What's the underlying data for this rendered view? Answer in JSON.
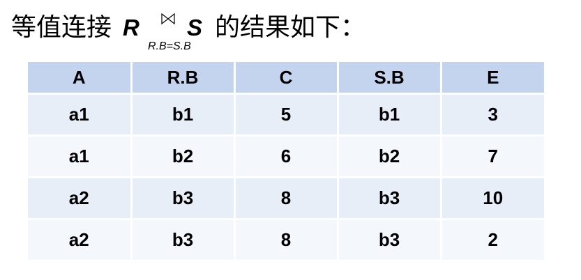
{
  "heading": {
    "prefix": "等值连接",
    "left_relation": "R",
    "join_symbol": "join-icon",
    "join_condition": "R.B=S.B",
    "right_relation": "S",
    "suffix": "的结果如下："
  },
  "table": {
    "headers": [
      "A",
      "R.B",
      "C",
      "S.B",
      "E"
    ],
    "rows": [
      [
        "a1",
        "b1",
        "5",
        "b1",
        "3"
      ],
      [
        "a1",
        "b2",
        "6",
        "b2",
        "7"
      ],
      [
        "a2",
        "b3",
        "8",
        "b3",
        "10"
      ],
      [
        "a2",
        "b3",
        "8",
        "b3",
        "2"
      ]
    ]
  },
  "colors": {
    "header_bg": "#c5d4ee",
    "row_odd_bg": "#e8eef8",
    "row_even_bg": "#f4f7fc"
  }
}
